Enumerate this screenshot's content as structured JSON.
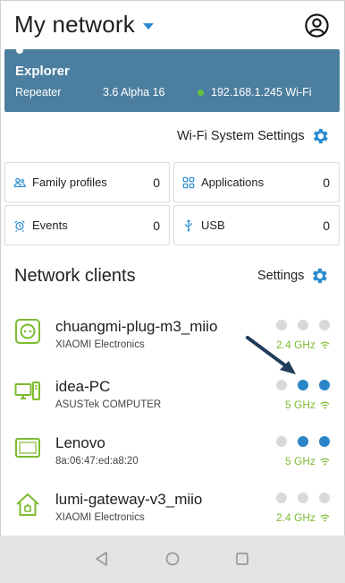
{
  "header": {
    "title": "My network"
  },
  "device": {
    "name": "Explorer",
    "role": "Repeater",
    "version": "3.6 Alpha 16",
    "status": "192.168.1.245 Wi-Fi",
    "status_color": "#62c43f"
  },
  "wifi_settings": {
    "label": "Wi-Fi System Settings"
  },
  "tiles": [
    {
      "label": "Family profiles",
      "count": "0",
      "icon": "family-icon"
    },
    {
      "label": "Applications",
      "count": "0",
      "icon": "applications-icon"
    },
    {
      "label": "Events",
      "count": "0",
      "icon": "events-icon"
    },
    {
      "label": "USB",
      "count": "0",
      "icon": "usb-icon"
    }
  ],
  "clients_header": {
    "title": "Network clients",
    "settings_label": "Settings"
  },
  "clients": [
    {
      "name": "chuangmi-plug-m3_miio",
      "sub": "XIAOMI Electronics",
      "band": "2.4 GHz",
      "icon": "smart-plug-icon"
    },
    {
      "name": "idea-PC",
      "sub": "ASUSTek COMPUTER",
      "band": "5 GHz",
      "icon": "desktop-pc-icon"
    },
    {
      "name": "Lenovo",
      "sub": "8a:06:47:ed:a8:20",
      "band": "5 GHz",
      "icon": "tablet-icon"
    },
    {
      "name": "lumi-gateway-v3_miio",
      "sub": "XIAOMI Electronics",
      "band": "2.4 GHz",
      "icon": "smart-home-icon"
    }
  ],
  "colors": {
    "accent": "#2a8bd0",
    "card": "#4c7e9f",
    "green": "#7dbb2f",
    "navbar": "#e3e3e3"
  }
}
